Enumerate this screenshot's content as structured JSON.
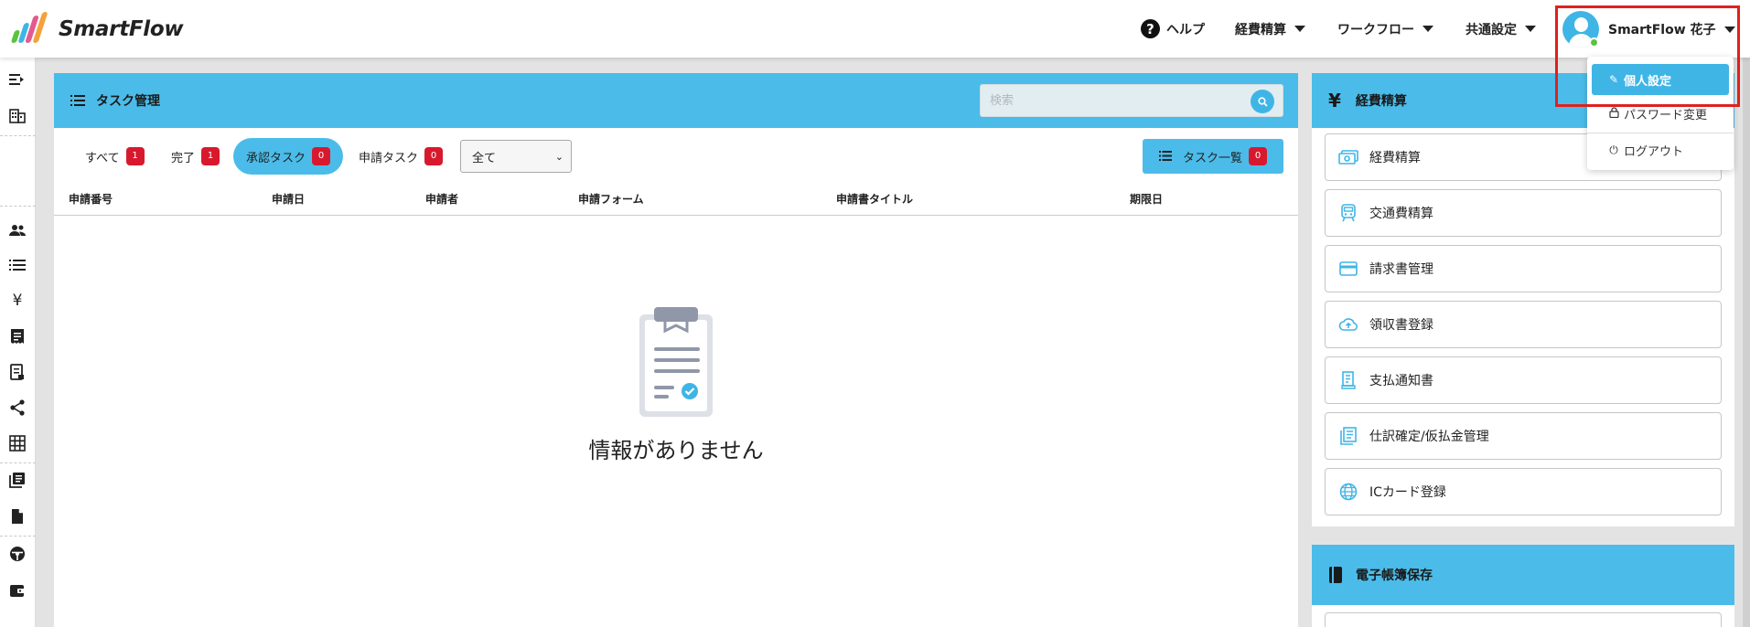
{
  "app": {
    "logo_text": "SmartFlow"
  },
  "topnav": {
    "help": "ヘルプ",
    "expense": "経費精算",
    "workflow": "ワークフロー",
    "common_settings": "共通設定",
    "user_name": "SmartFlow 花子"
  },
  "user_menu": {
    "items": [
      {
        "label": "個人設定",
        "icon": "pencil-icon"
      },
      {
        "label": "パスワード変更",
        "icon": "lock-icon"
      },
      {
        "label": "ログアウト",
        "icon": "power-icon"
      }
    ]
  },
  "task_panel": {
    "title": "タスク管理",
    "search_placeholder": "検索",
    "filters": [
      {
        "label": "すべて",
        "count": "1"
      },
      {
        "label": "完了",
        "count": "1"
      },
      {
        "label": "承認タスク",
        "count": "0"
      },
      {
        "label": "申請タスク",
        "count": "0"
      }
    ],
    "select_value": "全て",
    "list_button": {
      "label": "タスク一覧",
      "count": "0"
    },
    "columns": [
      "申請番号",
      "申請日",
      "申請者",
      "申請フォーム",
      "申請書タイトル",
      "期限日"
    ],
    "empty_message": "情報がありません"
  },
  "expense_panel": {
    "title": "経費精算",
    "items": [
      {
        "label": "経費精算",
        "icon": "money-icon"
      },
      {
        "label": "交通費精算",
        "icon": "train-icon"
      },
      {
        "label": "請求書管理",
        "icon": "credit-card-icon"
      },
      {
        "label": "領収書登録",
        "icon": "cloud-upload-icon"
      },
      {
        "label": "支払通知書",
        "icon": "receipt-icon"
      },
      {
        "label": "仕訳確定/仮払金管理",
        "icon": "journal-icon"
      },
      {
        "label": "ICカード登録",
        "icon": "globe-icon"
      }
    ]
  },
  "ebook_panel": {
    "title": "電子帳簿保存"
  },
  "colors": {
    "accent": "#4bbce9",
    "badge": "#d8192d",
    "highlight": "#e0201d"
  }
}
